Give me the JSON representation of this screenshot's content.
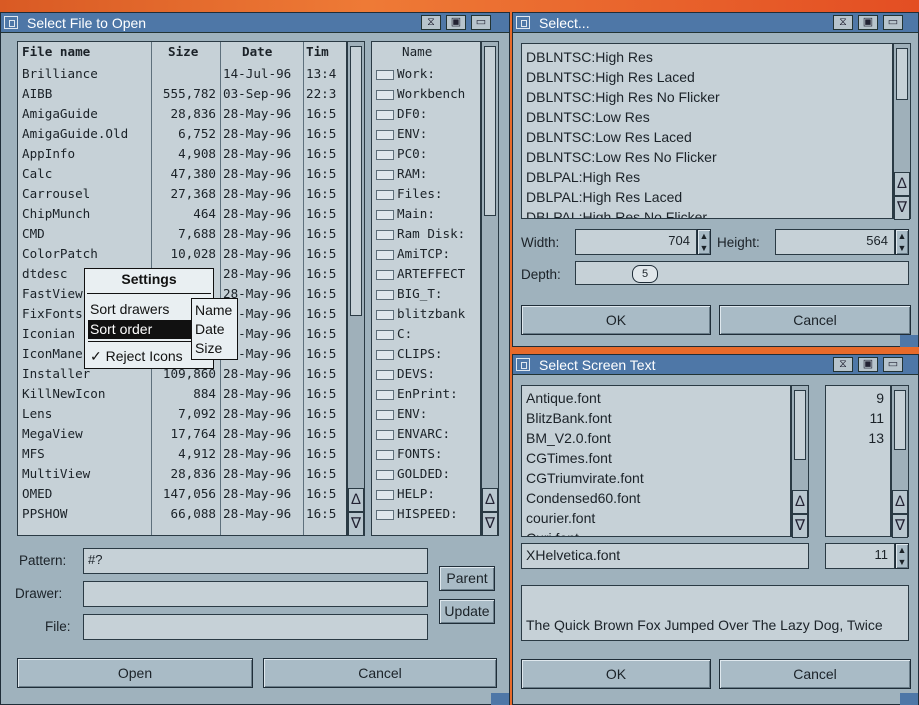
{
  "file_requester": {
    "title": "Select File to Open",
    "columns": {
      "name": "File name",
      "size": "Size",
      "date": "Date",
      "time": "Tim"
    },
    "files": [
      {
        "name": "Brilliance",
        "size": "",
        "date": "14-Jul-96",
        "time": "13:4"
      },
      {
        "name": "AIBB",
        "size": "555,782",
        "date": "03-Sep-96",
        "time": "22:3"
      },
      {
        "name": "AmigaGuide",
        "size": "28,836",
        "date": "28-May-96",
        "time": "16:5"
      },
      {
        "name": "AmigaGuide.Old",
        "size": "6,752",
        "date": "28-May-96",
        "time": "16:5"
      },
      {
        "name": "AppInfo",
        "size": "4,908",
        "date": "28-May-96",
        "time": "16:5"
      },
      {
        "name": "Calc",
        "size": "47,380",
        "date": "28-May-96",
        "time": "16:5"
      },
      {
        "name": "Carrousel",
        "size": "27,368",
        "date": "28-May-96",
        "time": "16:5"
      },
      {
        "name": "ChipMunch",
        "size": "464",
        "date": "28-May-96",
        "time": "16:5"
      },
      {
        "name": "CMD",
        "size": "7,688",
        "date": "28-May-96",
        "time": "16:5"
      },
      {
        "name": "ColorPatch",
        "size": "10,028",
        "date": "28-May-96",
        "time": "16:5"
      },
      {
        "name": "dtdesc",
        "size": "",
        "date": "28-May-96",
        "time": "16:5"
      },
      {
        "name": "FastView",
        "size": "",
        "date": "28-May-96",
        "time": "16:5"
      },
      {
        "name": "FixFonts",
        "size": "",
        "date": "28-May-96",
        "time": "16:5"
      },
      {
        "name": "Iconian",
        "size": "",
        "date": "28-May-96",
        "time": "16:5"
      },
      {
        "name": "IconMane",
        "size": "",
        "date": "28-May-96",
        "time": "16:5"
      },
      {
        "name": "Installer",
        "size": "109,860",
        "date": "28-May-96",
        "time": "16:5"
      },
      {
        "name": "KillNewIcon",
        "size": "884",
        "date": "28-May-96",
        "time": "16:5"
      },
      {
        "name": "Lens",
        "size": "7,092",
        "date": "28-May-96",
        "time": "16:5"
      },
      {
        "name": "MegaView",
        "size": "17,764",
        "date": "28-May-96",
        "time": "16:5"
      },
      {
        "name": "MFS",
        "size": "4,912",
        "date": "28-May-96",
        "time": "16:5"
      },
      {
        "name": "MultiView",
        "size": "28,836",
        "date": "28-May-96",
        "time": "16:5"
      },
      {
        "name": "OMED",
        "size": "147,056",
        "date": "28-May-96",
        "time": "16:5"
      },
      {
        "name": "PPSHOW",
        "size": "66,088",
        "date": "28-May-96",
        "time": "16:5"
      }
    ],
    "volumes_header": "Name",
    "volumes": [
      "Work:",
      "Workbench",
      "DF0:",
      "ENV:",
      "PC0:",
      "RAM:",
      "Files:",
      "Main:",
      "Ram Disk:",
      "AmiTCP:",
      "ARTEFFECT",
      "BIG_T:",
      "blitzbank",
      "C:",
      "CLIPS:",
      "DEVS:",
      "EnPrint:",
      "ENV:",
      "ENVARC:",
      "FONTS:",
      "GOLDED:",
      "HELP:",
      "HISPEED:"
    ],
    "pattern_label": "Pattern:",
    "pattern_value": "#?",
    "drawer_label": "Drawer:",
    "drawer_value": "",
    "file_label": "File:",
    "file_value": "",
    "parent_button": "Parent",
    "update_button": "Update",
    "open_button": "Open",
    "cancel_button": "Cancel"
  },
  "settings_menu": {
    "title": "Settings",
    "items": [
      "Sort drawers",
      "Sort order",
      "Reject Icons"
    ],
    "submenu": [
      "Name",
      "Date",
      "Size"
    ],
    "selected_item": "Sort order",
    "checked_item": "Reject Icons",
    "check_mark": "✓"
  },
  "screenmode_requester": {
    "title": "Select...",
    "modes": [
      "DBLNTSC:High Res",
      "DBLNTSC:High Res Laced",
      "DBLNTSC:High Res No Flicker",
      "DBLNTSC:Low Res",
      "DBLNTSC:Low Res Laced",
      "DBLNTSC:Low Res No Flicker",
      "DBLPAL:High Res",
      "DBLPAL:High Res Laced",
      "DBLPAL:High Res No Flicker"
    ],
    "width_label": "Width:",
    "width_value": "704",
    "height_label": "Height:",
    "height_value": "564",
    "depth_label": "Depth:",
    "depth_value": "5",
    "ok_button": "OK",
    "cancel_button": "Cancel"
  },
  "font_requester": {
    "title": "Select Screen Text",
    "fonts": [
      "Antique.font",
      "BlitzBank.font",
      "BM_V2.0.font",
      "CGTimes.font",
      "CGTriumvirate.font",
      "Condensed60.font",
      "courier.font",
      "Curi.font"
    ],
    "sizes": [
      "9",
      "11",
      "13"
    ],
    "selected_font": "XHelvetica.font",
    "selected_size": "11",
    "preview_text": "The Quick Brown Fox Jumped Over The Lazy Dog, Twice",
    "ok_button": "OK",
    "cancel_button": "Cancel"
  }
}
